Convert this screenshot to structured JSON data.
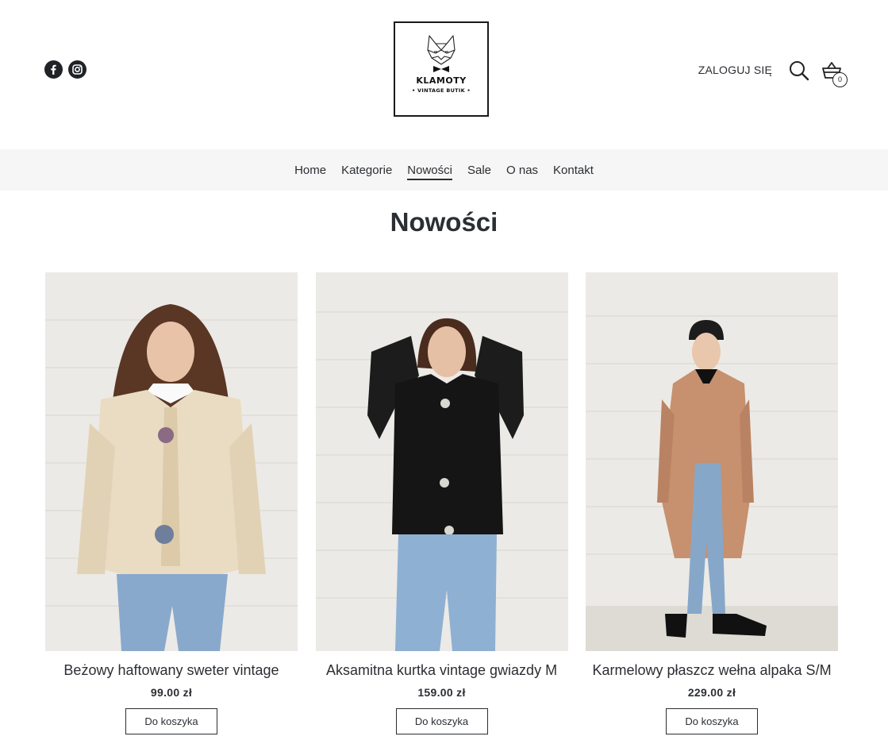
{
  "header": {
    "logo": {
      "name": "KLAMOTY",
      "subtitle": "• VINTAGE BUTIK •"
    },
    "social": [
      "facebook-icon",
      "instagram-icon"
    ],
    "account_label": "ZALOGUJ SIĘ",
    "cart_count": "0"
  },
  "nav": {
    "items": [
      "Home",
      "Kategorie",
      "Nowości",
      "Sale",
      "O nas",
      "Kontakt"
    ],
    "active": "Nowości"
  },
  "page": {
    "title": "Nowości"
  },
  "products": [
    {
      "name": "Beżowy haftowany sweter vintage",
      "price": "99.00 zł",
      "button": "Do koszyka"
    },
    {
      "name": "Aksamitna kurtka vintage gwiazdy M",
      "price": "159.00 zł",
      "button": "Do koszyka"
    },
    {
      "name": "Karmelowy płaszcz wełna alpaka S/M",
      "price": "229.00 zł",
      "button": "Do koszyka"
    }
  ],
  "colors": {
    "text": "#2b2e33",
    "nav_bg": "#f6f6f6",
    "wall": "#eceae6",
    "sweater": "#e9dcc3",
    "jacket": "#151515",
    "coat": "#c7906f",
    "denim": "#88a9cc"
  }
}
